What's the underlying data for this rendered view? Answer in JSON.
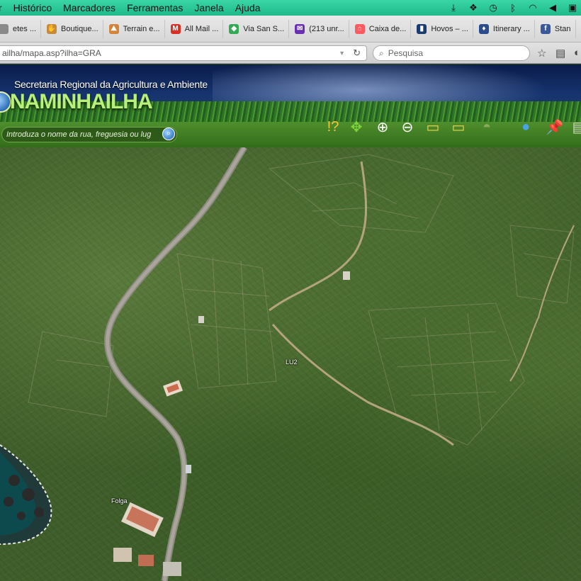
{
  "menubar": {
    "items": [
      "r",
      "Histórico",
      "Marcadores",
      "Ferramentas",
      "Janela",
      "Ajuda"
    ],
    "icons": [
      "download-icon",
      "dropbox-icon",
      "time-machine-icon",
      "bluetooth-icon",
      "wifi-icon",
      "volume-icon",
      "display-icon"
    ]
  },
  "bookmarks": [
    {
      "label": "etes ...",
      "icon": "page-icon",
      "color": "#8a8a8a",
      "glyph": ""
    },
    {
      "label": "Boutique...",
      "icon": "hand-icon",
      "color": "#c58a3c",
      "glyph": "✋"
    },
    {
      "label": "Terrain e...",
      "icon": "terrain-icon",
      "color": "#d4843a",
      "glyph": "⛰"
    },
    {
      "label": "All Mail ...",
      "icon": "gmail-icon",
      "color": "#d93025",
      "glyph": "M"
    },
    {
      "label": "Via San S...",
      "icon": "maps-icon",
      "color": "#34a853",
      "glyph": "◆"
    },
    {
      "label": "(213 unr...",
      "icon": "yahoo-mail-icon",
      "color": "#6b2fb3",
      "glyph": "✉"
    },
    {
      "label": "Caixa de...",
      "icon": "airbnb-icon",
      "color": "#ff5a5f",
      "glyph": "⌂"
    },
    {
      "label": "Hovos – ...",
      "icon": "hovos-icon",
      "color": "#1b3b6f",
      "glyph": "▮"
    },
    {
      "label": "Itinerary ...",
      "icon": "shield-icon",
      "color": "#2b4c8c",
      "glyph": "♦"
    },
    {
      "label": "Stan",
      "icon": "facebook-icon",
      "color": "#3b5998",
      "glyph": "f"
    }
  ],
  "nav": {
    "url": "ailha/mapa.asp?ilha=GRA",
    "search_placeholder": "Pesquisa"
  },
  "site": {
    "subtitle": "Secretaria Regional da Agricultura e Ambiente",
    "logo": "NAMINHAILHA",
    "place_placeholder": "Introduza o nome da rua, freguesia ou lug"
  },
  "tools": [
    {
      "name": "info-tool-icon",
      "glyph": "!?"
    },
    {
      "name": "pan-tool-icon",
      "glyph": "✥"
    },
    {
      "name": "zoom-in-tool-icon",
      "glyph": "⊕"
    },
    {
      "name": "zoom-out-tool-icon",
      "glyph": "⊖"
    },
    {
      "name": "measure-distance-tool-icon",
      "glyph": "▭"
    },
    {
      "name": "measure-area-tool-icon",
      "glyph": "▭"
    },
    {
      "name": "island-extent-tool-icon",
      "glyph": "◓"
    },
    {
      "name": "globe-tool-icon",
      "glyph": "●"
    },
    {
      "name": "pin-tool-icon",
      "glyph": "📌"
    },
    {
      "name": "print-tool-icon",
      "glyph": "▤"
    }
  ],
  "map": {
    "labels": [
      "LU2",
      "Folga"
    ]
  },
  "colors": {
    "menubar": "#2ac99a",
    "logo": "#b9f07a",
    "header_sky": "#0a1c4a",
    "header_green": "#3d7d27"
  }
}
